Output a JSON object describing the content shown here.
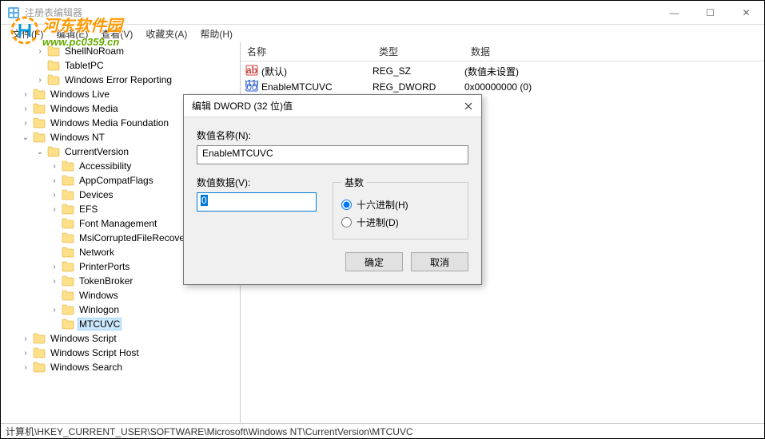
{
  "window": {
    "title": "注册表编辑器",
    "buttons": {
      "min": "—",
      "max": "☐",
      "close": "✕"
    }
  },
  "watermark": {
    "cn": "河东软件园",
    "url": "www.pc0359.cn"
  },
  "menu": {
    "file": "文件(F)",
    "edit": "编辑(E)",
    "view": "查看(V)",
    "fav": "收藏夹(A)",
    "help": "帮助(H)"
  },
  "tree": [
    {
      "indent": 2,
      "toggle": ">",
      "label": "ShellNoRoam"
    },
    {
      "indent": 2,
      "toggle": "",
      "label": "TabletPC"
    },
    {
      "indent": 2,
      "toggle": ">",
      "label": "Windows Error Reporting"
    },
    {
      "indent": 1,
      "toggle": ">",
      "label": "Windows Live"
    },
    {
      "indent": 1,
      "toggle": ">",
      "label": "Windows Media"
    },
    {
      "indent": 1,
      "toggle": ">",
      "label": "Windows Media Foundation"
    },
    {
      "indent": 1,
      "toggle": "v",
      "label": "Windows NT"
    },
    {
      "indent": 2,
      "toggle": "v",
      "label": "CurrentVersion"
    },
    {
      "indent": 3,
      "toggle": ">",
      "label": "Accessibility"
    },
    {
      "indent": 3,
      "toggle": ">",
      "label": "AppCompatFlags"
    },
    {
      "indent": 3,
      "toggle": ">",
      "label": "Devices"
    },
    {
      "indent": 3,
      "toggle": ">",
      "label": "EFS"
    },
    {
      "indent": 3,
      "toggle": "",
      "label": "Font Management"
    },
    {
      "indent": 3,
      "toggle": "",
      "label": "MsiCorruptedFileRecovery"
    },
    {
      "indent": 3,
      "toggle": "",
      "label": "Network"
    },
    {
      "indent": 3,
      "toggle": ">",
      "label": "PrinterPorts"
    },
    {
      "indent": 3,
      "toggle": ">",
      "label": "TokenBroker"
    },
    {
      "indent": 3,
      "toggle": "",
      "label": "Windows"
    },
    {
      "indent": 3,
      "toggle": ">",
      "label": "Winlogon"
    },
    {
      "indent": 3,
      "toggle": "",
      "label": "MTCUVC",
      "selected": true
    },
    {
      "indent": 1,
      "toggle": ">",
      "label": "Windows Script"
    },
    {
      "indent": 1,
      "toggle": ">",
      "label": "Windows Script Host"
    },
    {
      "indent": 1,
      "toggle": ">",
      "label": "Windows Search"
    }
  ],
  "list": {
    "headers": {
      "name": "名称",
      "type": "类型",
      "data": "数据"
    },
    "rows": [
      {
        "icon": "ab",
        "name": "(默认)",
        "type": "REG_SZ",
        "data": "(数值未设置)"
      },
      {
        "icon": "bin",
        "name": "EnableMTCUVC",
        "type": "REG_DWORD",
        "data": "0x00000000 (0)"
      }
    ]
  },
  "dialog": {
    "title": "编辑 DWORD (32 位)值",
    "name_label": "数值名称(N):",
    "name_value": "EnableMTCUVC",
    "data_label": "数值数据(V):",
    "data_value": "0",
    "base_label": "基数",
    "hex": "十六进制(H)",
    "dec": "十进制(D)",
    "ok": "确定",
    "cancel": "取消"
  },
  "status": "计算机\\HKEY_CURRENT_USER\\SOFTWARE\\Microsoft\\Windows NT\\CurrentVersion\\MTCUVC"
}
